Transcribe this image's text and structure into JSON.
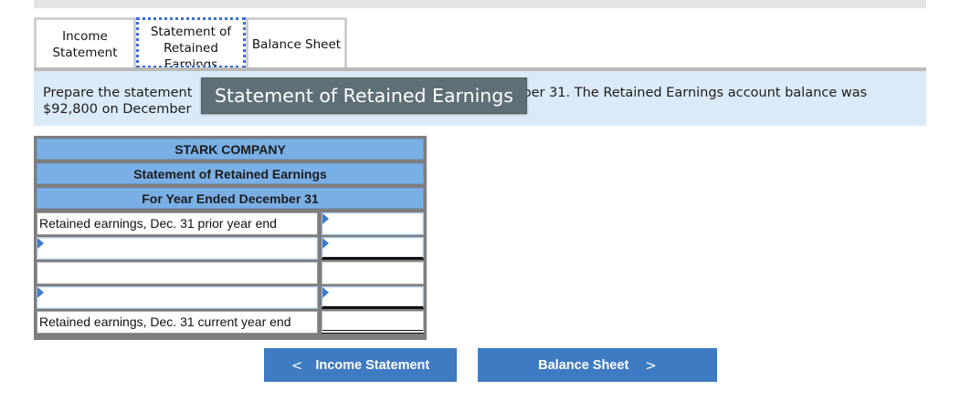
{
  "tabs": [
    {
      "label": "Income\nStatement"
    },
    {
      "label": "Statement of\nRetained\nEarnings"
    },
    {
      "label": "Balance Sheet"
    }
  ],
  "instruction": {
    "line1_start": "Prepare the statement",
    "line1_end": "ber 31. The Retained Earnings account balance was",
    "line2": "$92,800 on December"
  },
  "tooltip": "Statement of Retained Earnings",
  "statement": {
    "company": "STARK COMPANY",
    "title": "Statement of Retained Earnings",
    "period": "For Year Ended December 31",
    "rows": [
      {
        "label": "Retained earnings, Dec. 31 prior year end",
        "value": ""
      },
      {
        "label": "",
        "value": ""
      },
      {
        "label": "",
        "value": ""
      },
      {
        "label": "",
        "value": ""
      },
      {
        "label": "Retained earnings, Dec. 31 current year end",
        "value": ""
      }
    ]
  },
  "buttons": {
    "prev_label": "Income Statement",
    "next_label": "Balance Sheet",
    "prev_icon": "chevron-left-icon",
    "next_icon": "chevron-right-icon"
  },
  "colors": {
    "header_blue": "#7aafe6",
    "instruction_bg": "#dbeaf7",
    "button_blue": "#3f7bc3",
    "tooltip_bg": "#5f6f78"
  }
}
